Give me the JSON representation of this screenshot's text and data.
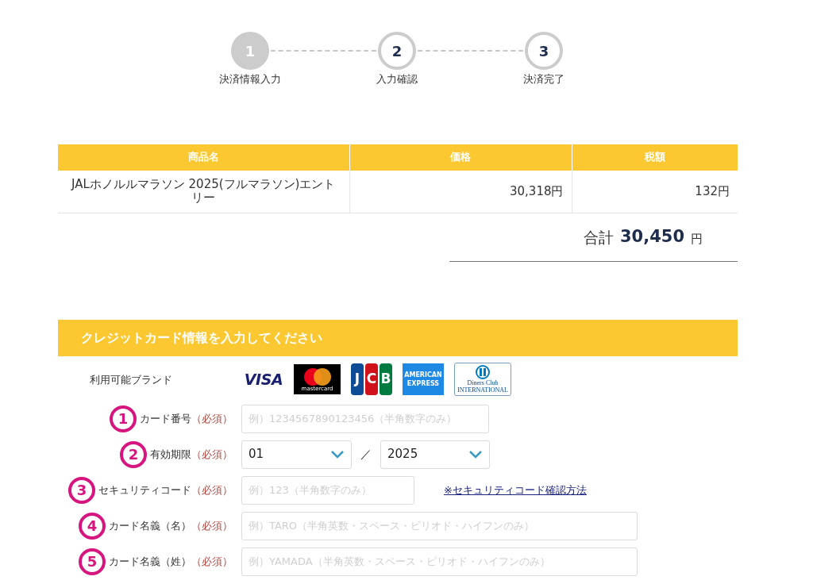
{
  "steps": [
    {
      "number": "1",
      "label": "決済情報入力",
      "selected": true
    },
    {
      "number": "2",
      "label": "入力確認",
      "selected": false
    },
    {
      "number": "3",
      "label": "決済完了",
      "selected": false
    }
  ],
  "order_table": {
    "columns": [
      "商品名",
      "価格",
      "税額"
    ],
    "rows": [
      [
        "JALホノルルマラソン 2025(フルマラソン)エントリー",
        "30,318円",
        "132円"
      ]
    ]
  },
  "total": {
    "label": "合計",
    "amount": "30,450",
    "unit": "円"
  },
  "card_section": {
    "title": "クレジットカード情報を入力してください",
    "brands_label": "利用可能ブランド",
    "brands": [
      {
        "kind": "visa",
        "lines": [
          "VISA"
        ]
      },
      {
        "kind": "mastercard",
        "lines": [
          "mastercard"
        ]
      },
      {
        "kind": "jcb",
        "lines": [
          "J",
          "C",
          "B"
        ]
      },
      {
        "kind": "amex",
        "lines": [
          "AMERICAN",
          "EXPRESS"
        ]
      },
      {
        "kind": "diners",
        "lines": [
          "Diners Club",
          "INTERNATIONAL"
        ]
      }
    ],
    "fields": [
      {
        "kind": "input",
        "marker": "1",
        "label": "カード番号",
        "required": "（必須）",
        "placeholder": "例）1234567890123456（半角数字のみ）"
      },
      {
        "kind": "expiry",
        "marker": "2",
        "label": "有効期限",
        "required": "（必須）",
        "month": "01",
        "separator": "／",
        "year": "2025"
      },
      {
        "kind": "input",
        "marker": "3",
        "label": "セキュリティコード",
        "required": "（必須）",
        "placeholder": "例）123（半角数字のみ）",
        "link": "※セキュリティコード確認方法"
      },
      {
        "kind": "input",
        "marker": "4",
        "label": "カード名義（名）",
        "required": "（必須）",
        "placeholder": "例）TARO（半角英数・スペース・ピリオド・ハイフンのみ）"
      },
      {
        "kind": "input",
        "marker": "5",
        "label": "カード名義（姓）",
        "required": "（必須）",
        "placeholder": "例）YAMADA（半角英数・スペース・ピリオド・ハイフンのみ）"
      }
    ]
  }
}
